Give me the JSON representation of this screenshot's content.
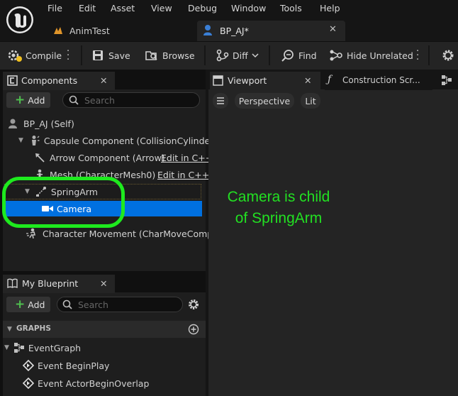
{
  "menu": [
    "File",
    "Edit",
    "Asset",
    "View",
    "Debug",
    "Window",
    "Tools",
    "Help"
  ],
  "tabs": [
    {
      "label": "AnimTest",
      "icon": "anim-asset-icon"
    },
    {
      "label": "BP_AJ*",
      "icon": "blueprint-person-icon"
    }
  ],
  "toolbar": {
    "compile": "Compile",
    "save": "Save",
    "browse": "Browse",
    "diff": "Diff",
    "find": "Find",
    "hide_unrelated": "Hide Unrelated"
  },
  "components_panel": {
    "title": "Components",
    "add_label": "Add",
    "search_placeholder": "Search",
    "tree": [
      {
        "label": "BP_AJ (Self)",
        "indent": 0
      },
      {
        "label": "Capsule Component (CollisionCylinder)",
        "indent": 1,
        "expanded": true
      },
      {
        "label": "Arrow Component (Arrow)",
        "indent": 2,
        "link": "Edit in C++"
      },
      {
        "label": "Mesh (CharacterMesh0)",
        "indent": 2,
        "link": "Edit in C++"
      },
      {
        "label": "SpringArm",
        "indent": 2,
        "expanded": true
      },
      {
        "label": "Camera",
        "indent": 3,
        "selected": true
      },
      {
        "label": "Character Movement (CharMoveComp)",
        "indent": 1
      }
    ]
  },
  "viewport": {
    "tab_viewport": "Viewport",
    "tab_construction": "Construction Scr...",
    "perspective": "Perspective",
    "lit": "Lit"
  },
  "annotation": {
    "line1": "Camera is child",
    "line2": "of SpringArm",
    "color": "#22e022"
  },
  "my_blueprint": {
    "title": "My Blueprint",
    "add_label": "Add",
    "search_placeholder": "Search",
    "section": "GRAPHS",
    "graph": "EventGraph",
    "events": [
      "Event BeginPlay",
      "Event ActorBeginOverlap"
    ]
  },
  "colors": {
    "selection": "#0070e0",
    "accent_green": "#1eea1e"
  }
}
